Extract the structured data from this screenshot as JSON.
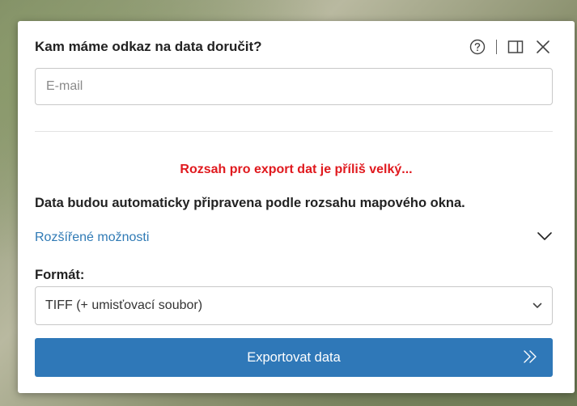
{
  "dialog": {
    "title": "Kam máme odkaz na data doručit?",
    "email_placeholder": "E-mail",
    "warning": "Rozsah pro export dat je příliš velký...",
    "info": "Data budou automaticky připravena podle rozsahu mapového okna.",
    "advanced_label": "Rozšířené možnosti",
    "format_label": "Formát:",
    "format_selected": "TIFF (+ umisťovací soubor)",
    "export_label": "Exportovat data"
  },
  "icons": {
    "help": "help-circle-icon",
    "dock": "dock-panel-icon",
    "close": "close-icon",
    "expand": "chevron-down-icon",
    "select": "select-chevron-icon",
    "export": "double-chevron-right-icon"
  },
  "colors": {
    "warning": "#e0191e",
    "link": "#2f7ab5",
    "button": "#2f78b8"
  }
}
